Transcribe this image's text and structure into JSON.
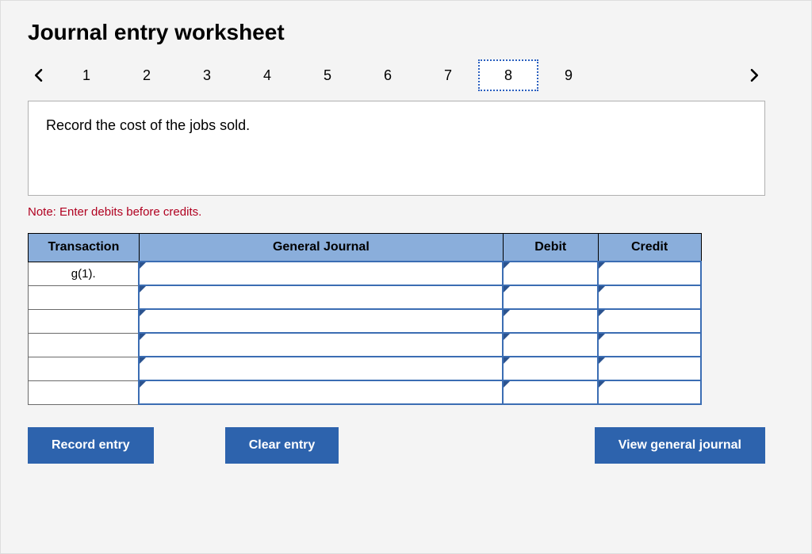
{
  "title": "Journal entry worksheet",
  "tabs": {
    "items": [
      "1",
      "2",
      "3",
      "4",
      "5",
      "6",
      "7",
      "8",
      "9"
    ],
    "active_index": 7
  },
  "instruction": "Record the cost of the jobs sold.",
  "note": "Note: Enter debits before credits.",
  "headers": {
    "transaction": "Transaction",
    "general_journal": "General Journal",
    "debit": "Debit",
    "credit": "Credit"
  },
  "rows": [
    {
      "transaction": "g(1).",
      "journal": "",
      "debit": "",
      "credit": ""
    },
    {
      "transaction": "",
      "journal": "",
      "debit": "",
      "credit": ""
    },
    {
      "transaction": "",
      "journal": "",
      "debit": "",
      "credit": ""
    },
    {
      "transaction": "",
      "journal": "",
      "debit": "",
      "credit": ""
    },
    {
      "transaction": "",
      "journal": "",
      "debit": "",
      "credit": ""
    },
    {
      "transaction": "",
      "journal": "",
      "debit": "",
      "credit": ""
    }
  ],
  "buttons": {
    "record": "Record entry",
    "clear": "Clear entry",
    "view": "View general journal"
  }
}
